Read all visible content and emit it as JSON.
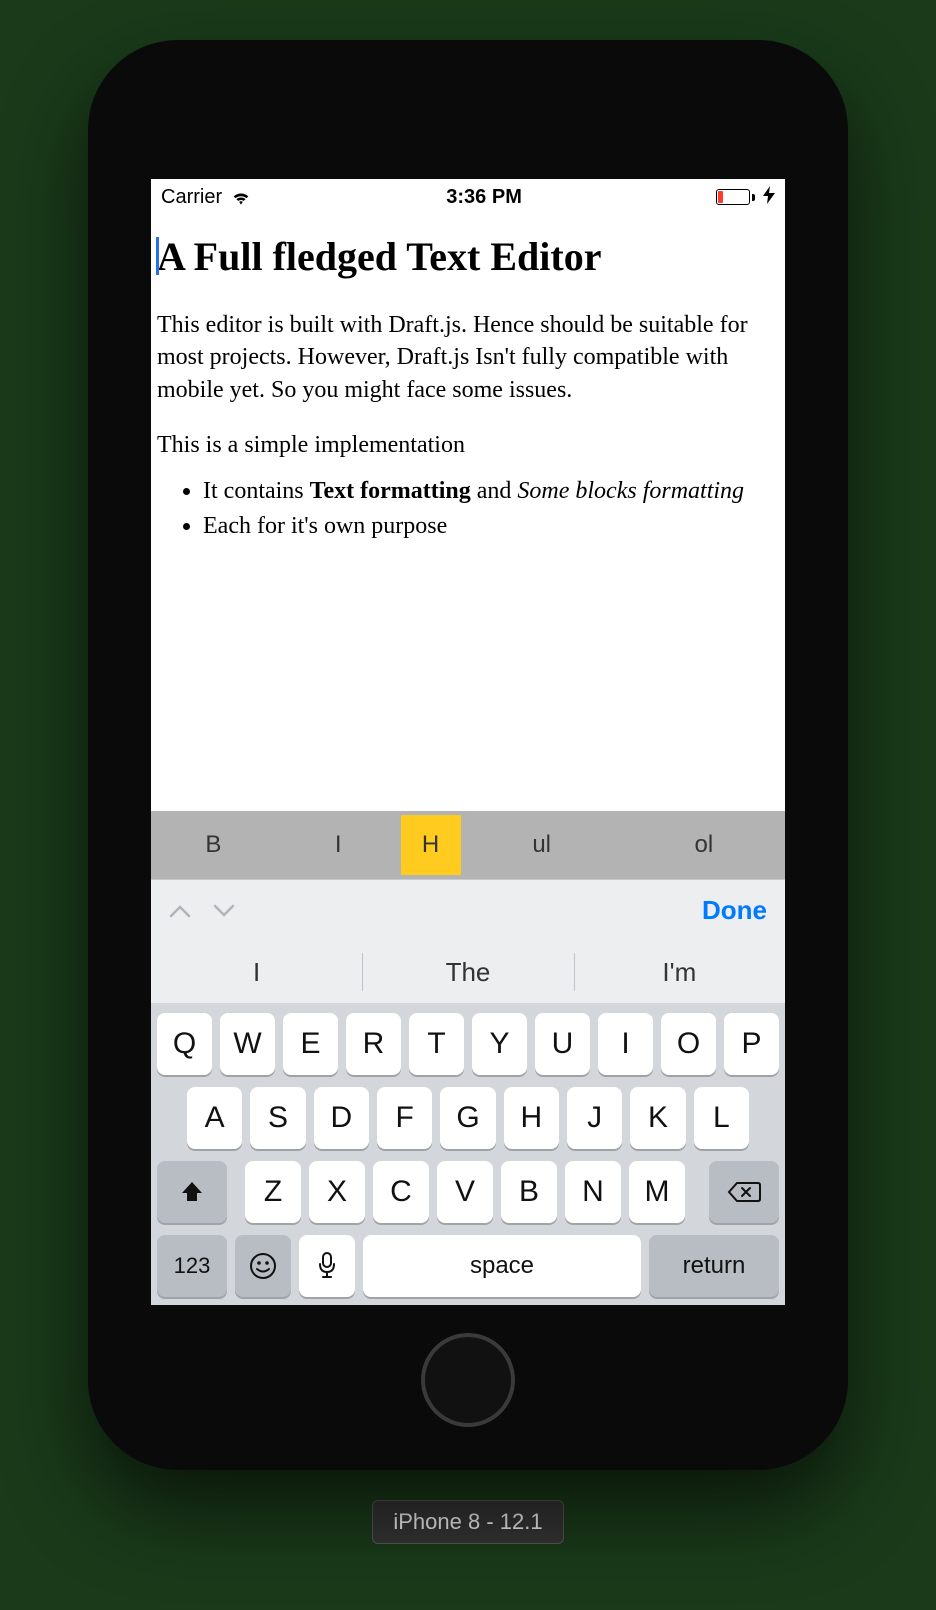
{
  "status": {
    "carrier": "Carrier",
    "time": "3:36 PM"
  },
  "editor": {
    "title": "A Full fledged Text Editor",
    "paragraph": "This editor is built with Draft.js. Hence should be suitable for most projects. However, Draft.js Isn't fully compatible with mobile yet. So you might face some issues.",
    "subline": "This is a simple implementation",
    "bullets": [
      {
        "pre": "It contains ",
        "bold": "Text formatting",
        "mid": " and ",
        "italic": "Some blocks formatting"
      },
      {
        "pre": "Each for it's own purpose",
        "bold": "",
        "mid": "",
        "italic": ""
      }
    ]
  },
  "toolbar": {
    "bold": "B",
    "italic": "I",
    "heading": "H",
    "ul": "ul",
    "ol": "ol",
    "active": "heading"
  },
  "accessory": {
    "done": "Done"
  },
  "suggestions": [
    "I",
    "The",
    "I'm"
  ],
  "keyboard": {
    "row1": [
      "Q",
      "W",
      "E",
      "R",
      "T",
      "Y",
      "U",
      "I",
      "O",
      "P"
    ],
    "row2": [
      "A",
      "S",
      "D",
      "F",
      "G",
      "H",
      "J",
      "K",
      "L"
    ],
    "row3": [
      "Z",
      "X",
      "C",
      "V",
      "B",
      "N",
      "M"
    ],
    "numKey": "123",
    "space": "space",
    "returnKey": "return"
  },
  "deviceLabel": "iPhone 8 - 12.1"
}
